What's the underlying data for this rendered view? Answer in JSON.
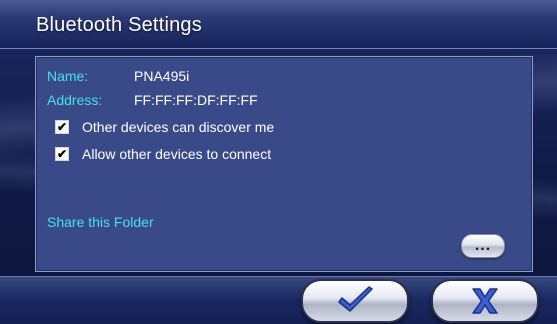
{
  "window": {
    "title": "Bluetooth Settings"
  },
  "info": {
    "name_label": "Name:",
    "name_value": "PNA495i",
    "address_label": "Address:",
    "address_value": "FF:FF:FF:DF:FF:FF"
  },
  "options": [
    {
      "label": "Other devices can discover me",
      "checked": true
    },
    {
      "label": "Allow other devices to connect",
      "checked": true
    }
  ],
  "share": {
    "label": "Share this Folder",
    "browse_label": "..."
  },
  "buttons": {
    "ok_icon": "checkmark-icon",
    "cancel_icon": "x-icon"
  },
  "colors": {
    "accent_label": "#45e1ea",
    "panel": "#3a4a88",
    "title_bar": "#2b3a74"
  }
}
